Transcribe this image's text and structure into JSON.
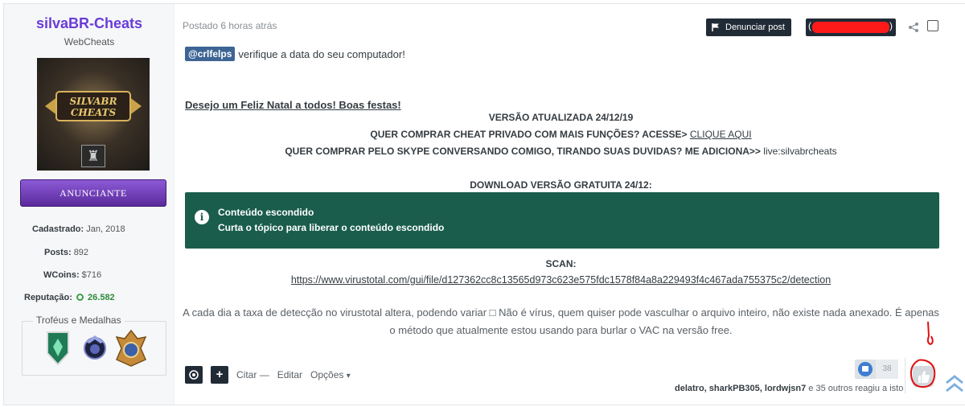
{
  "author": {
    "name": "silvaBR-Cheats",
    "group": "WebCheats",
    "avatar_text": "SILVABR CHEATS",
    "badge": "ANUNCIANTE",
    "stats": [
      {
        "label": "Cadastrado:",
        "value": "Jan, 2018"
      },
      {
        "label": "Posts:",
        "value": "892"
      },
      {
        "label": "WCoins:",
        "value": "$716"
      },
      {
        "label": "Reputação:",
        "value": "26.582"
      }
    ],
    "trophies_title": "Troféus e Medalhas",
    "colors": {
      "name": "#6a3bd8",
      "badge": "#6b3bb3",
      "reputation": "#2e8b3c"
    }
  },
  "post": {
    "date": "Postado 6 horas atrás",
    "report_label": "Denunciar post",
    "report_icon": "flag-icon",
    "share_icon": "share-icon",
    "mention": "@crlfelps",
    "mention_text": "verifique a data do seu computador!",
    "xmas_link": "Desejo um Feliz Natal a todos! Boas festas!",
    "version_line": "VERSÃO ATUALIZADA 24/12/19",
    "buy_line_prefix": "QUER COMPRAR CHEAT PRIVADO COM MAIS FUNÇÕES? ACESSE>",
    "buy_line_link": "CLIQUE AQUI",
    "skype_line_prefix": "QUER COMPRAR PELO SKYPE CONVERSANDO COMIGO, TIRANDO SUAS DUVIDAS? ME ADICIONA>>",
    "skype_line_id": "live:silvabrcheats",
    "download_line": "DOWNLOAD VERSÃO GRATUITA 24/12:",
    "hidden": {
      "title": "Conteúdo escondido",
      "subtitle": "Curta o tópico para liberar o conteúdo escondido",
      "color": "#1a5d4c"
    },
    "scan_label": "SCAN:",
    "scan_url": "https://www.virustotal.com/gui/file/d127362cc8c13565d973c623e575fdc1578f84a8a229493f4c467ada755375c2/detection",
    "paragraph_line1": "A cada dia a taxa de detecção no virustotal altera, podendo variar □ Não é vírus, quem quiser pode vasculhar o arquivo inteiro, não existe nada anexado. É apenas",
    "paragraph_line2": "o método que atualmente estou usando para burlar o VAC na versão free."
  },
  "footer": {
    "quote": "Citar",
    "quote_suffix": "—",
    "edit": "Editar",
    "options": "Opções",
    "options_caret": "▾",
    "add_symbol": "+",
    "reaction_count": "38",
    "reactors_names": "delatro, sharkPB305, lordwjsn7",
    "reactors_rest": "e 35 outros reagiu a isto"
  }
}
